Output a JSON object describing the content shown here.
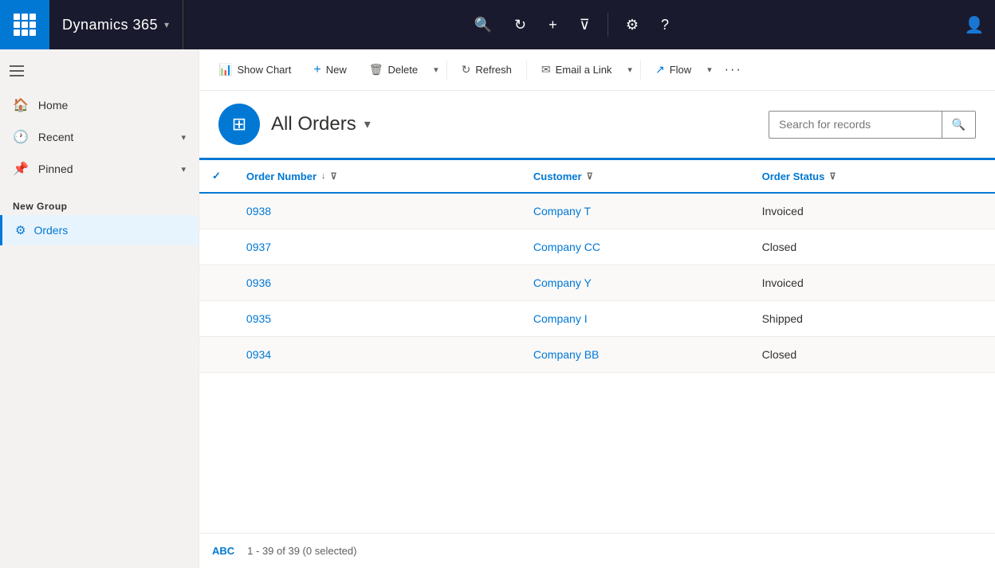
{
  "topnav": {
    "brand": "Dynamics 365",
    "brand_chevron": "▾"
  },
  "toolbar": {
    "show_chart": "Show Chart",
    "new": "New",
    "delete": "Delete",
    "refresh": "Refresh",
    "email_a_link": "Email a Link",
    "flow": "Flow"
  },
  "page": {
    "title": "All Orders",
    "title_chevron": "▾",
    "search_placeholder": "Search for records"
  },
  "sidebar": {
    "nav": [
      {
        "label": "Home",
        "icon": "🏠"
      },
      {
        "label": "Recent",
        "icon": "🕐"
      },
      {
        "label": "Pinned",
        "icon": "📌"
      }
    ],
    "section": "New Group",
    "items": [
      {
        "label": "Orders",
        "icon": "⚙"
      }
    ]
  },
  "grid": {
    "columns": [
      {
        "label": "Order Number",
        "sortable": true,
        "filterable": true
      },
      {
        "label": "Customer",
        "sortable": false,
        "filterable": true
      },
      {
        "label": "Order Status",
        "sortable": false,
        "filterable": true
      }
    ],
    "rows": [
      {
        "order_number": "0938",
        "customer": "Company T",
        "status": "Invoiced"
      },
      {
        "order_number": "0937",
        "customer": "Company CC",
        "status": "Closed"
      },
      {
        "order_number": "0936",
        "customer": "Company Y",
        "status": "Invoiced"
      },
      {
        "order_number": "0935",
        "customer": "Company I",
        "status": "Shipped"
      },
      {
        "order_number": "0934",
        "customer": "Company BB",
        "status": "Closed"
      }
    ],
    "footer": {
      "abc": "ABC",
      "count": "1 - 39 of 39 (0 selected)"
    }
  }
}
